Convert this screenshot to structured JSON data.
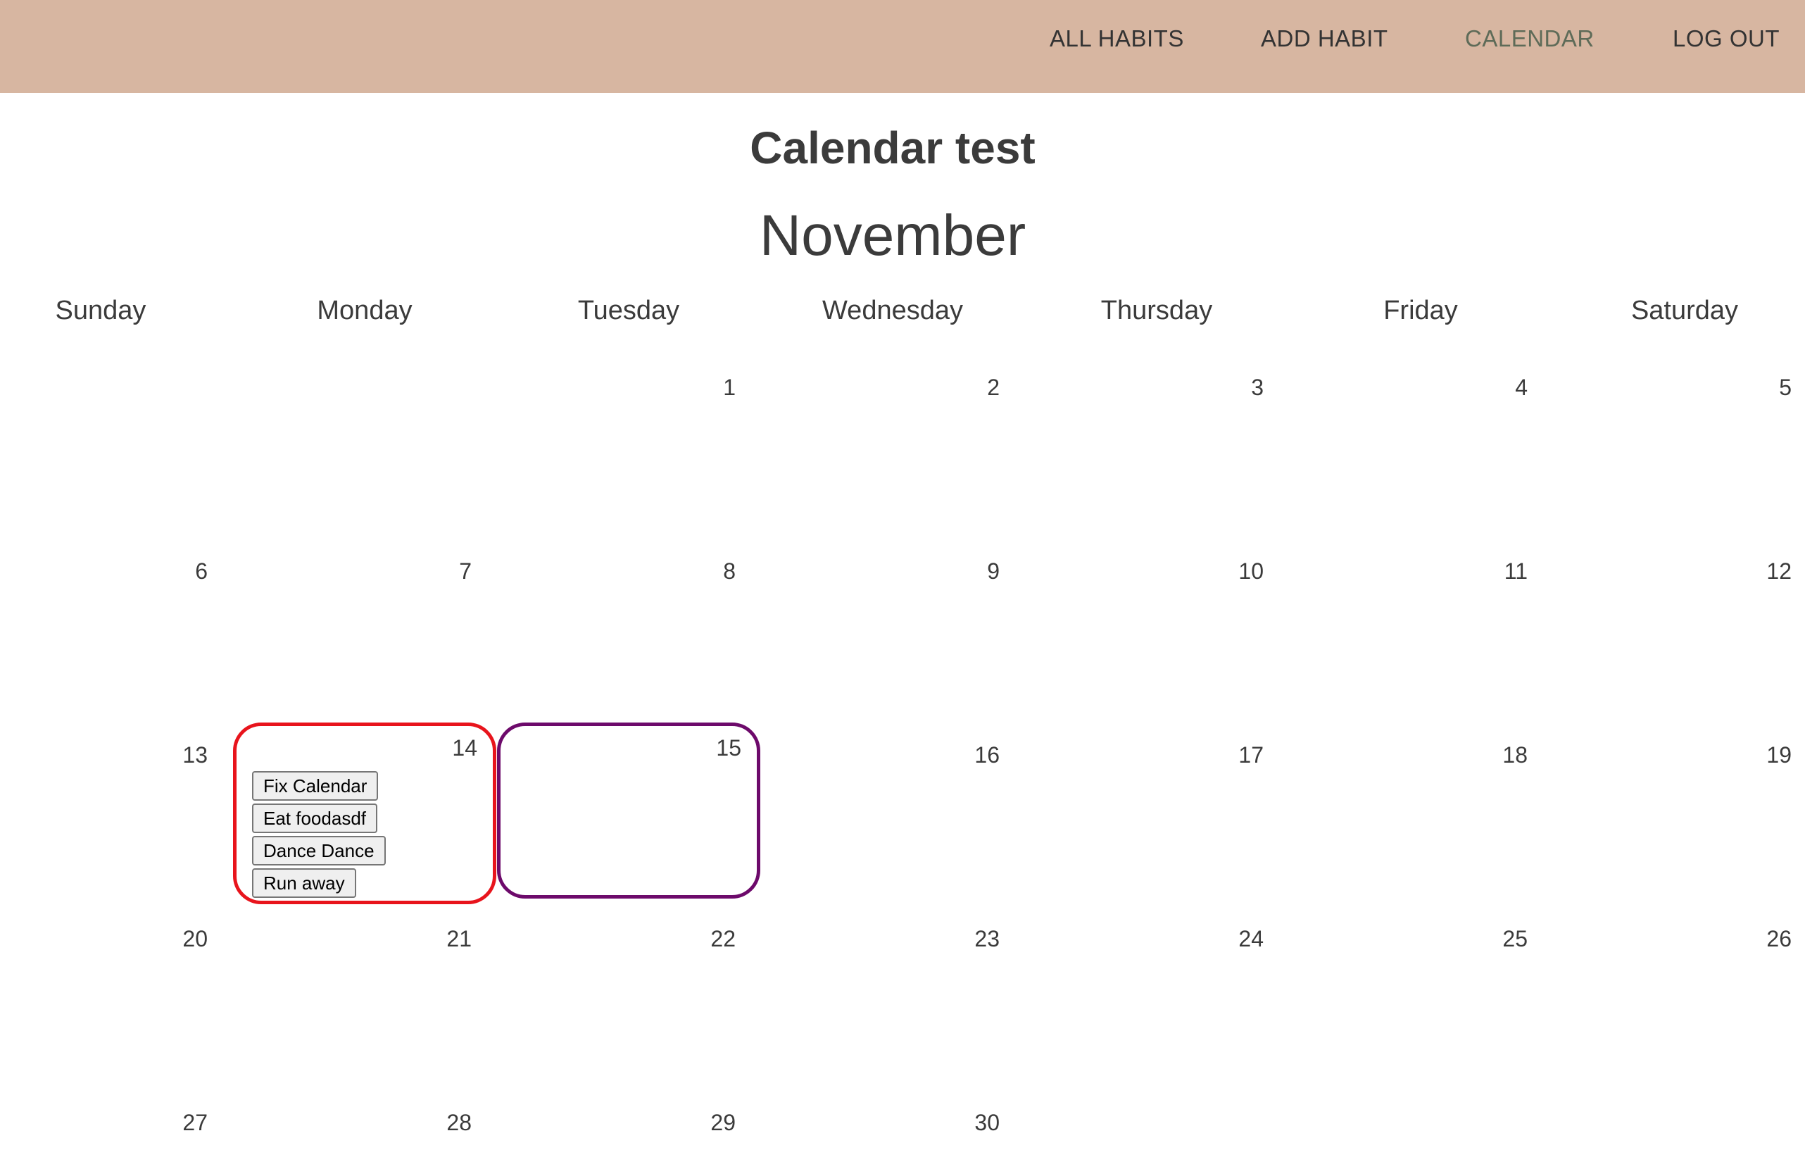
{
  "nav": {
    "items": [
      {
        "label": "ALL HABITS"
      },
      {
        "label": "ADD HABIT"
      },
      {
        "label": "CALENDAR"
      },
      {
        "label": "LOG OUT"
      }
    ],
    "active": "CALENDAR",
    "bar_color": "#d7b6a1",
    "active_color": "#5e6b58"
  },
  "page": {
    "title": "Calendar test",
    "month": "November"
  },
  "weekdays": [
    "Sunday",
    "Monday",
    "Tuesday",
    "Wednesday",
    "Thursday",
    "Friday",
    "Saturday"
  ],
  "calendar": {
    "first_weekday_index": 2,
    "days_in_month": 30,
    "days": {
      "1": "1",
      "2": "2",
      "3": "3",
      "4": "4",
      "5": "5",
      "6": "6",
      "7": "7",
      "8": "8",
      "9": "9",
      "10": "10",
      "11": "11",
      "12": "12",
      "13": "13",
      "14": "14",
      "15": "15",
      "16": "16",
      "17": "17",
      "18": "18",
      "19": "19",
      "20": "20",
      "21": "21",
      "22": "22",
      "23": "23",
      "24": "24",
      "25": "25",
      "26": "26",
      "27": "27",
      "28": "28",
      "29": "29",
      "30": "30"
    },
    "highlighted_days": {
      "14": {
        "border_color": "#e8141c"
      },
      "15": {
        "border_color": "#6d0a6b"
      }
    },
    "day14_habits": [
      "Fix Calendar",
      "Eat foodasdf",
      "Dance Dance",
      "Run away"
    ]
  }
}
